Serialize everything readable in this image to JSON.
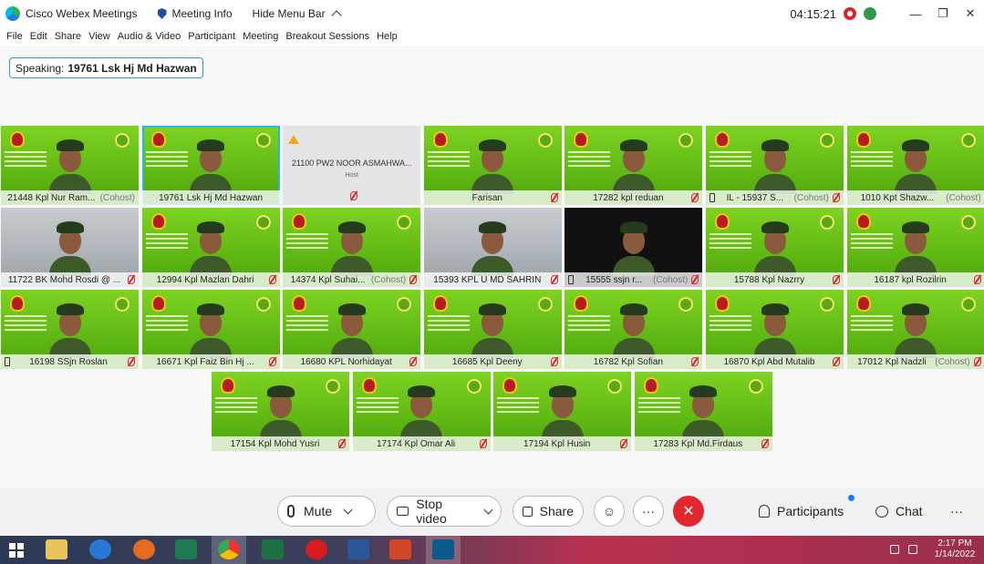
{
  "titlebar": {
    "app_name": "Cisco Webex Meetings",
    "meeting_info": "Meeting Info",
    "hide_menu": "Hide Menu Bar",
    "time": "04:15:21"
  },
  "menu": [
    "File",
    "Edit",
    "Share",
    "View",
    "Audio & Video",
    "Participant",
    "Meeting",
    "Breakout Sessions",
    "Help"
  ],
  "speaking": {
    "prefix": "Speaking:",
    "name": "19761 Lsk Hj Md Hazwan"
  },
  "participants": [
    {
      "name": "21448 Kpl Nur Ram...",
      "tag": "(Cohost)",
      "muted": false,
      "phone": false,
      "style": "green"
    },
    {
      "name": "19761 Lsk Hj Md Hazwan",
      "tag": "",
      "muted": false,
      "phone": false,
      "style": "green",
      "active": true
    },
    {
      "name": "21100 PW2 NOOR ASMAHWA...",
      "tag": "Host",
      "muted": true,
      "phone": false,
      "style": "host"
    },
    {
      "name": "Farisan",
      "tag": "",
      "muted": true,
      "phone": false,
      "style": "green"
    },
    {
      "name": "17282 kpl reduan",
      "tag": "",
      "muted": true,
      "phone": false,
      "style": "green"
    },
    {
      "name": "IL - 15937 S...",
      "tag": "(Cohost)",
      "muted": true,
      "phone": true,
      "style": "green"
    },
    {
      "name": "1010 Kpt Shazw...",
      "tag": "(Cohost)",
      "muted": false,
      "phone": false,
      "style": "green"
    },
    {
      "name": "11722 BK Mohd Rosdi @ ...",
      "tag": "",
      "muted": true,
      "phone": false,
      "style": "gray"
    },
    {
      "name": "12994 Kpl Mazlan Dahri",
      "tag": "",
      "muted": true,
      "phone": false,
      "style": "green"
    },
    {
      "name": "14374 Kpl Suhai...",
      "tag": "(Cohost)",
      "muted": true,
      "phone": false,
      "style": "green"
    },
    {
      "name": "15393 KPL U MD SAHRIN",
      "tag": "",
      "muted": true,
      "phone": false,
      "style": "gray"
    },
    {
      "name": "15555 ssjn r...",
      "tag": "(Cohost)",
      "muted": true,
      "phone": true,
      "style": "dark"
    },
    {
      "name": "15788 Kpl Nazrry",
      "tag": "",
      "muted": true,
      "phone": false,
      "style": "green"
    },
    {
      "name": "16187 kpl Rozilrin",
      "tag": "",
      "muted": true,
      "phone": false,
      "style": "green"
    },
    {
      "name": "16198 SSjn Roslan",
      "tag": "",
      "muted": true,
      "phone": true,
      "style": "green"
    },
    {
      "name": "16671 Kpl Faiz Bin Hj ...",
      "tag": "",
      "muted": true,
      "phone": false,
      "style": "green"
    },
    {
      "name": "16680 KPL Norhidayat",
      "tag": "",
      "muted": true,
      "phone": false,
      "style": "green"
    },
    {
      "name": "16685 Kpl Deeny",
      "tag": "",
      "muted": true,
      "phone": false,
      "style": "green"
    },
    {
      "name": "16782 Kpl Sofian",
      "tag": "",
      "muted": true,
      "phone": false,
      "style": "green"
    },
    {
      "name": "16870 Kpl Abd Mutalib",
      "tag": "",
      "muted": true,
      "phone": false,
      "style": "green"
    },
    {
      "name": "17012 Kpl Nadzli",
      "tag": "(Cohost)",
      "muted": true,
      "phone": false,
      "style": "green"
    },
    {
      "name": "17154 Kpl Mohd Yusri",
      "tag": "",
      "muted": true,
      "phone": false,
      "style": "green"
    },
    {
      "name": "17174 Kpl Omar Ali",
      "tag": "",
      "muted": true,
      "phone": false,
      "style": "green"
    },
    {
      "name": "17194 Kpl Husin",
      "tag": "",
      "muted": true,
      "phone": false,
      "style": "green"
    },
    {
      "name": "17283 Kpl Md.Firdaus",
      "tag": "",
      "muted": true,
      "phone": false,
      "style": "green"
    }
  ],
  "controls": {
    "mute": "Mute",
    "stop_video": "Stop video",
    "share": "Share",
    "more": "···",
    "end": "✕",
    "participants": "Participants",
    "chat": "Chat"
  },
  "taskbar": {
    "time": "2:17 PM",
    "date": "1/14/2022"
  },
  "colors": {
    "accent": "#2bb6d9",
    "end": "#e0282e",
    "tile_green": "#7ed321"
  }
}
